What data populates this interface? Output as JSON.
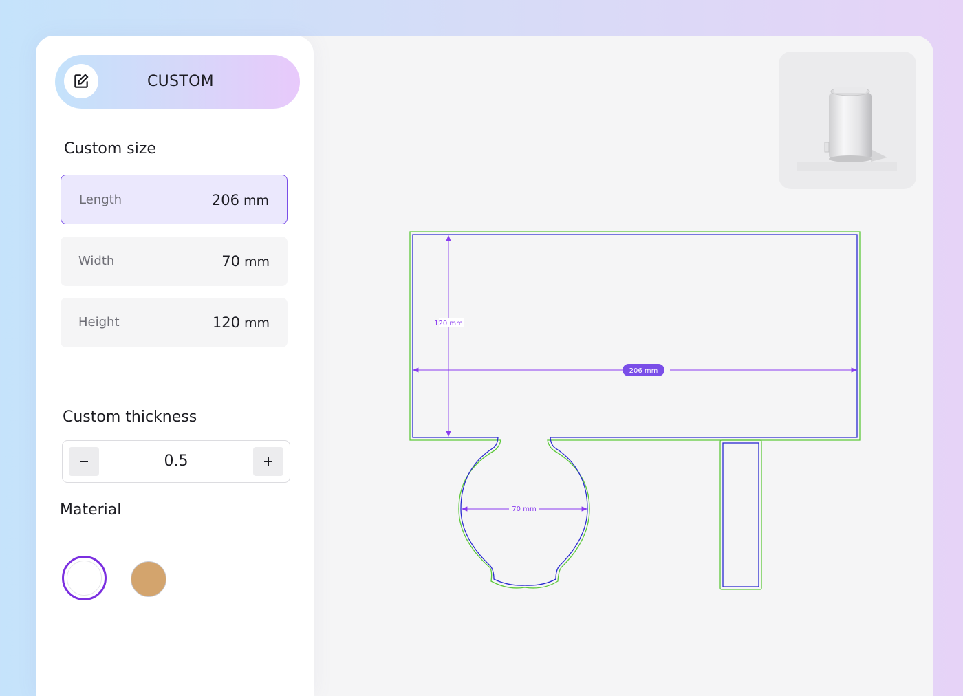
{
  "mode": {
    "label": "CUSTOM",
    "icon": "edit-icon"
  },
  "custom_size": {
    "title": "Custom size",
    "fields": [
      {
        "name": "Length",
        "value": "206",
        "unit": "mm"
      },
      {
        "name": "Width",
        "value": "70",
        "unit": "mm"
      },
      {
        "name": "Height",
        "value": "120",
        "unit": "mm"
      }
    ]
  },
  "thickness": {
    "title": "Custom thickness",
    "value": "0.5",
    "minus_label": "−",
    "plus_label": "+"
  },
  "material": {
    "title": "Material",
    "options": [
      {
        "name": "white",
        "color": "#ffffff",
        "selected": true
      },
      {
        "name": "kraft",
        "color": "#d3a46d",
        "selected": false
      }
    ]
  },
  "dieline": {
    "height_label": "120 mm",
    "length_label": "206 mm",
    "width_label": "70 mm",
    "colors": {
      "cut": "#2a2ad0",
      "bleed": "#5dc93a",
      "dimension": "#8a3cf0"
    }
  },
  "preview": {
    "icon": "can-sleeve-preview-icon"
  }
}
